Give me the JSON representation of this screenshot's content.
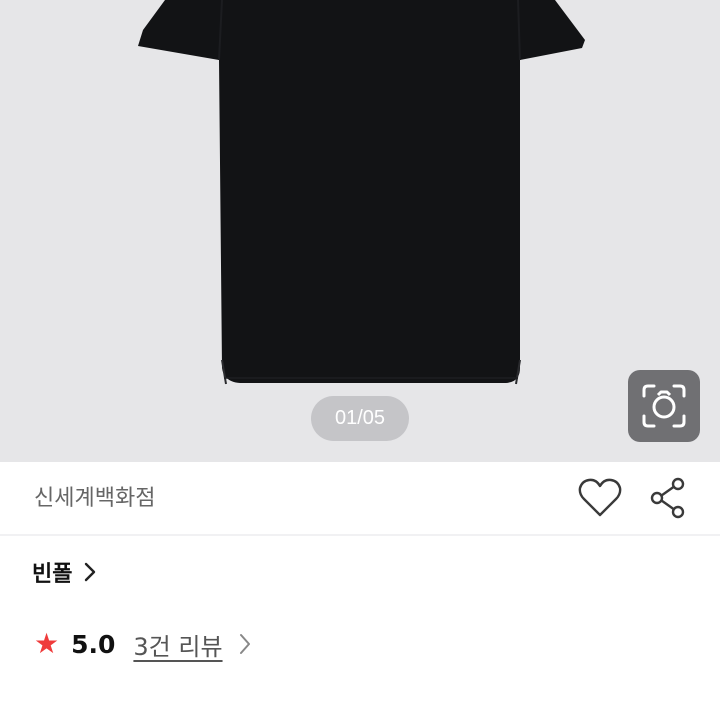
{
  "gallery": {
    "page_indicator": "01/05",
    "image_icon": "black-polo-shirt",
    "lens_icon": "camera-lens-icon"
  },
  "store": {
    "name": "신세계백화점",
    "heart_icon": "heart-icon",
    "share_icon": "share-icon"
  },
  "brand": {
    "name": "빈폴",
    "chevron_icon": "chevron-right-icon"
  },
  "rating": {
    "star_icon": "star-icon",
    "score": "5.0",
    "reviews_label": "3건 리뷰",
    "chevron_icon": "chevron-right-icon"
  },
  "colors": {
    "accent_star": "#ef3b3b",
    "gallery_bg": "#e6e6e8",
    "shirt": "#111214"
  }
}
